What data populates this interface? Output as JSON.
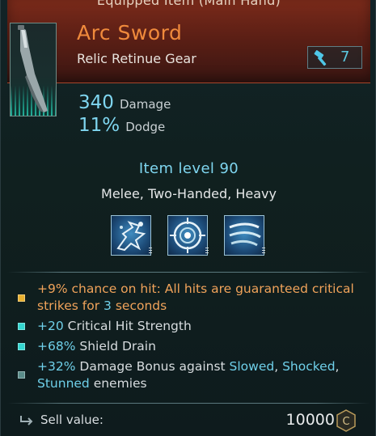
{
  "header": {
    "equipped_label": "Equipped Item (Main Hand)",
    "item_name": "Arc Sword",
    "item_subtitle": "Relic Retinue Gear",
    "rank_icon": "hammer-icon",
    "rank_value": "7"
  },
  "stats": [
    {
      "value": "340",
      "label": "Damage"
    },
    {
      "value": "11%",
      "label": "Dodge"
    }
  ],
  "item_level": "Item level 90",
  "tags": "Melee, Two-Handed, Heavy",
  "skills": [
    {
      "icon": "shatter-burst-icon"
    },
    {
      "icon": "target-ring-icon"
    },
    {
      "icon": "wind-slash-icon"
    }
  ],
  "affixes": [
    {
      "bullet_color": "#e8b030",
      "parts": [
        {
          "text": "+9%",
          "color": "orange"
        },
        {
          "text": " chance on hit: All hits are guaranteed critical strikes for ",
          "color": "orange"
        },
        {
          "text": "3",
          "color": "cyan"
        },
        {
          "text": " seconds",
          "color": "orange"
        }
      ]
    },
    {
      "bullet_color": "#35d6d0",
      "parts": [
        {
          "text": "+20",
          "color": "cyan"
        },
        {
          "text": " Critical Hit Strength",
          "color": "plain"
        }
      ]
    },
    {
      "bullet_color": "#35d6d0",
      "parts": [
        {
          "text": "+68%",
          "color": "cyan"
        },
        {
          "text": " Shield Drain",
          "color": "plain"
        }
      ]
    },
    {
      "bullet_color": "#5a8c8a",
      "parts": [
        {
          "text": "+32%",
          "color": "cyan"
        },
        {
          "text": " Damage Bonus against ",
          "color": "plain"
        },
        {
          "text": "Slowed",
          "color": "cyan"
        },
        {
          "text": ", ",
          "color": "plain"
        },
        {
          "text": "Shocked",
          "color": "cyan"
        },
        {
          "text": ", ",
          "color": "plain"
        },
        {
          "text": "Stunned",
          "color": "cyan"
        },
        {
          "text": " enemies",
          "color": "plain"
        }
      ]
    }
  ],
  "sell": {
    "label": "Sell value:",
    "value": "10000",
    "currency_icon": "credits-coin-icon"
  }
}
